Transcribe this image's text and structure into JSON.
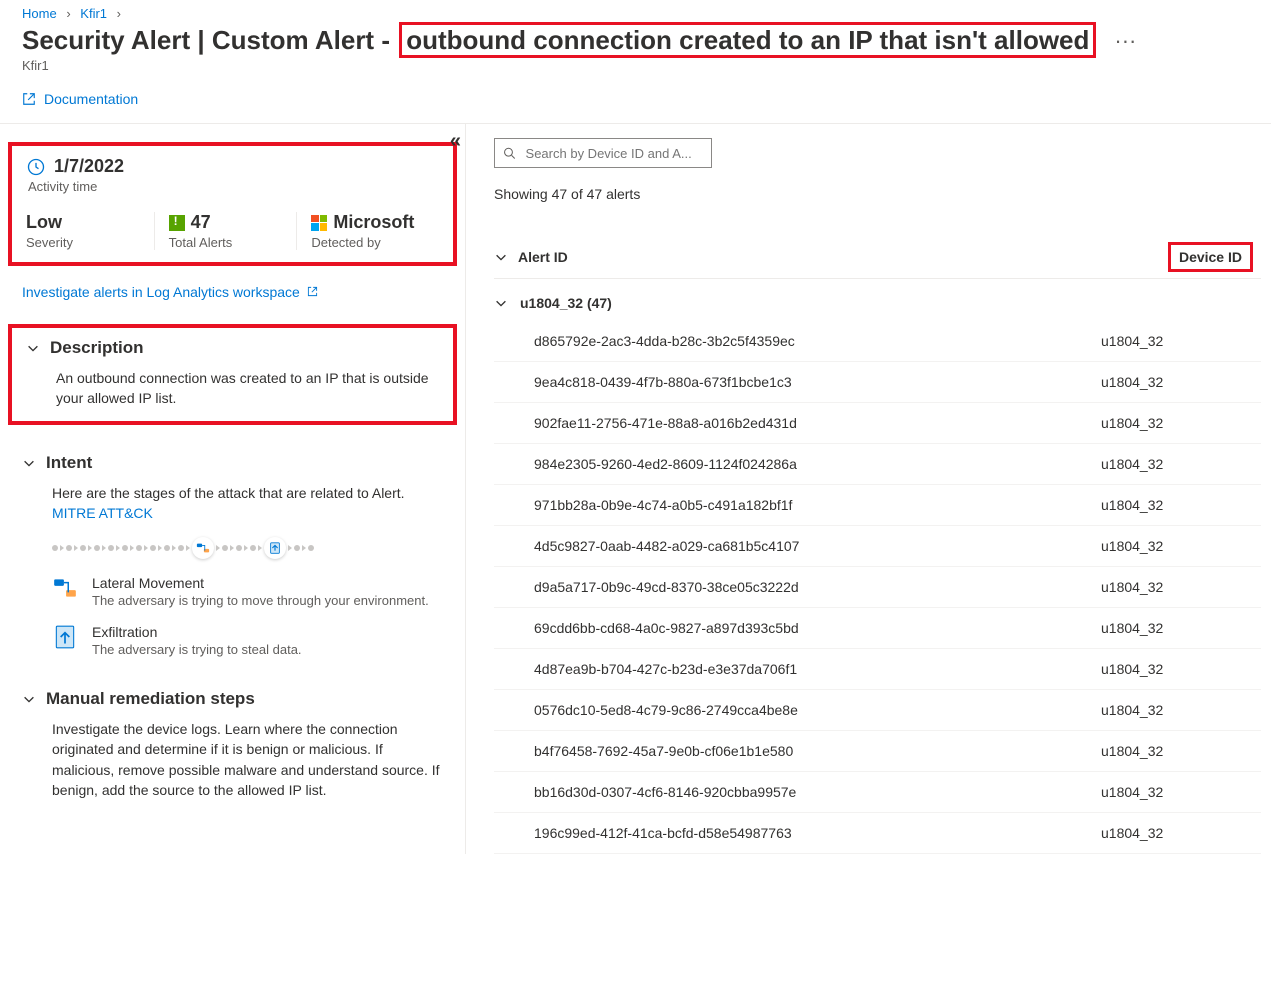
{
  "breadcrumbs": {
    "home": "Home",
    "hub": "Kfir1"
  },
  "page": {
    "title_prefix": "Security Alert | Custom Alert - ",
    "title_hl": "outbound connection created to an IP that isn't allowed",
    "subtitle": "Kfir1",
    "doc_link": "Documentation"
  },
  "summary": {
    "activity_date": "1/7/2022",
    "activity_label": "Activity time",
    "severity_value": "Low",
    "severity_label": "Severity",
    "total_value": "47",
    "total_label": "Total Alerts",
    "detected_value": "Microsoft",
    "detected_label": "Detected by"
  },
  "links": {
    "investigate": "Investigate alerts in Log Analytics workspace"
  },
  "description": {
    "title": "Description",
    "body": "An outbound connection was created to an IP that is outside your allowed IP list."
  },
  "intent": {
    "title": "Intent",
    "body_pre": "Here are the stages of the attack that are related to Alert. ",
    "mitre": "MITRE ATT&CK",
    "items": [
      {
        "title": "Lateral Movement",
        "desc": "The adversary is trying to move through your environment."
      },
      {
        "title": "Exfiltration",
        "desc": "The adversary is trying to steal data."
      }
    ]
  },
  "remediation": {
    "title": "Manual remediation steps",
    "body": "Investigate the device logs. Learn where the connection originated and determine if it is benign or malicious. If malicious, remove possible malware and understand source. If benign, add the source to the allowed IP list."
  },
  "right": {
    "search_placeholder": "Search by Device ID and A...",
    "showing": "Showing 47 of 47 alerts",
    "col_alert": "Alert ID",
    "col_device": "Device ID",
    "group_label": "u1804_32 (47)",
    "rows": [
      {
        "alert": "d865792e-2ac3-4dda-b28c-3b2c5f4359ec",
        "device": "u1804_32"
      },
      {
        "alert": "9ea4c818-0439-4f7b-880a-673f1bcbe1c3",
        "device": "u1804_32"
      },
      {
        "alert": "902fae11-2756-471e-88a8-a016b2ed431d",
        "device": "u1804_32"
      },
      {
        "alert": "984e2305-9260-4ed2-8609-1124f024286a",
        "device": "u1804_32"
      },
      {
        "alert": "971bb28a-0b9e-4c74-a0b5-c491a182bf1f",
        "device": "u1804_32"
      },
      {
        "alert": "4d5c9827-0aab-4482-a029-ca681b5c4107",
        "device": "u1804_32"
      },
      {
        "alert": "d9a5a717-0b9c-49cd-8370-38ce05c3222d",
        "device": "u1804_32"
      },
      {
        "alert": "69cdd6bb-cd68-4a0c-9827-a897d393c5bd",
        "device": "u1804_32"
      },
      {
        "alert": "4d87ea9b-b704-427c-b23d-e3e37da706f1",
        "device": "u1804_32"
      },
      {
        "alert": "0576dc10-5ed8-4c79-9c86-2749cca4be8e",
        "device": "u1804_32"
      },
      {
        "alert": "b4f76458-7692-45a7-9e0b-cf06e1b1e580",
        "device": "u1804_32"
      },
      {
        "alert": "bb16d30d-0307-4cf6-8146-920cbba9957e",
        "device": "u1804_32"
      },
      {
        "alert": "196c99ed-412f-41ca-bcfd-d58e54987763",
        "device": "u1804_32"
      }
    ]
  }
}
